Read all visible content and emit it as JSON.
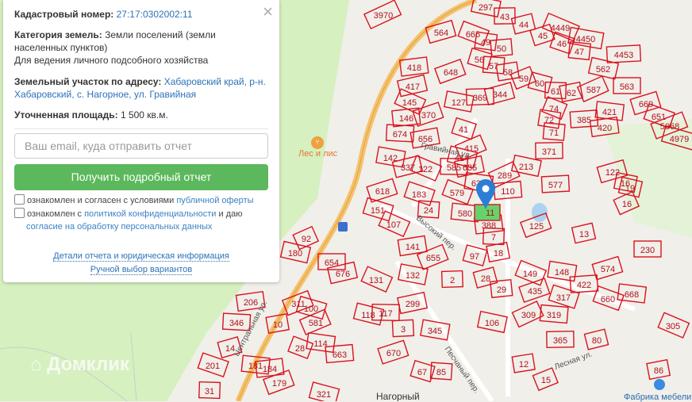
{
  "panel": {
    "cadastral_label": "Кадастровый номер:",
    "cadastral_value": "27:17:0302002:11",
    "category_label": "Категория земель:",
    "category_value": "Земли поселений (земли населенных пунктов)",
    "usage": "Для ведения личного подсобного хозяйства",
    "address_label": "Земельный участок по адресу:",
    "address_value": "Хабаровский край, р-н. Хабаровский, с. Нагорное, ул. Гравийная",
    "area_label": "Уточненная площадь:",
    "area_value": "1 500 кв.м.",
    "email_placeholder": "Ваш email, куда отправить отчет",
    "submit_label": "Получить подробный отчет",
    "consent1_text": "ознакомлен и согласен с условиями",
    "consent1_link": "публичной оферты",
    "consent2_text": "ознакомлен с",
    "consent2_link": "политикой конфиденциальности",
    "consent2_mid": "и даю",
    "consent2_link2": "согласие на обработку персональных данных",
    "details_link": "Детали отчета и юридическая информация",
    "manual_link": "Ручной выбор вариантов",
    "close_icon": "×"
  },
  "map": {
    "watermark": "Домклик",
    "poi_cafe": "Лес и лис",
    "poi_factory": "Фабрика мебели",
    "village": "Нагорный",
    "streets": [
      "Гравийная ул.",
      "Центральная ул.",
      "Высокий пер.",
      "Лесная ул.",
      "Песчаный пер."
    ],
    "selected_parcel": "11",
    "parcels": [
      "3970",
      "297",
      "43",
      "44",
      "4449",
      "4450",
      "4453",
      "564",
      "666",
      "49",
      "50",
      "45",
      "46",
      "47",
      "418",
      "648",
      "56",
      "57",
      "58",
      "59",
      "60",
      "61",
      "62",
      "587",
      "562",
      "563",
      "417",
      "145",
      "127",
      "369",
      "344",
      "74",
      "72",
      "385",
      "669",
      "651",
      "421",
      "146",
      "370",
      "41",
      "71",
      "420",
      "5068",
      "4979",
      "674",
      "656",
      "415",
      "414",
      "585",
      "635",
      "289",
      "213",
      "371",
      "337",
      "122",
      "142",
      "577",
      "122",
      "579",
      "634",
      "110",
      "618",
      "183",
      "580",
      "388",
      "125",
      "151",
      "24",
      "141",
      "655",
      "97",
      "7",
      "18",
      "92",
      "180",
      "654",
      "676",
      "131",
      "132",
      "2",
      "28",
      "149",
      "148",
      "422",
      "574",
      "660",
      "668",
      "29",
      "435",
      "317",
      "319",
      "206",
      "311",
      "100",
      "346",
      "10",
      "581",
      "118",
      "117",
      "299",
      "309",
      "106",
      "365",
      "80",
      "305",
      "345",
      "3",
      "14",
      "28",
      "114",
      "663",
      "670",
      "201",
      "181",
      "184",
      "179",
      "67",
      "85",
      "12",
      "15",
      "321",
      "31",
      "86",
      "16",
      "19",
      "230",
      "13",
      "107",
      "16"
    ],
    "colors": {
      "forest": "#d6f0c0",
      "parcel": "#d9121f",
      "selected": "#66d36a",
      "road": "#f5c26b",
      "marker": "#2a7fd4"
    }
  }
}
